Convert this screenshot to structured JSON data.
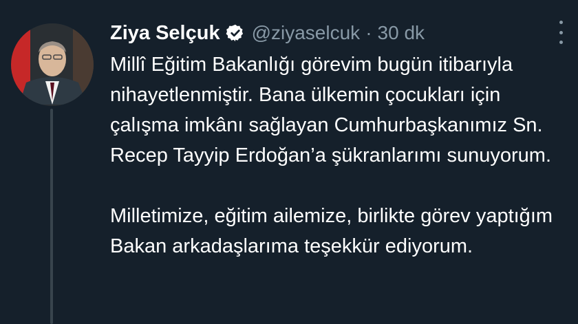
{
  "tweet": {
    "author_name": "Ziya Selçuk",
    "handle": "@ziyaselcuk",
    "separator": "·",
    "time": "30 dk",
    "paragraphs": [
      "Millî Eğitim Bakanlığı görevim bugün itibarıyla nihayetlenmiştir. Bana ülkemin çocukları için çalışma imkânı sağlayan Cumhurbaşkanımız Sn. Recep Tayyip Erdoğan’a şükranlarımı sunuyorum.",
      "Milletimize, eğitim ailemize, birlikte görev yaptığım Bakan arkadaşlarıma teşekkür ediyorum."
    ]
  },
  "icons": {
    "verified": "verified-badge-icon",
    "more": "more-options-icon"
  },
  "colors": {
    "background": "#15202b",
    "secondary_text": "#8899a6",
    "primary_text": "#ffffff",
    "thread_line": "#38444d"
  }
}
